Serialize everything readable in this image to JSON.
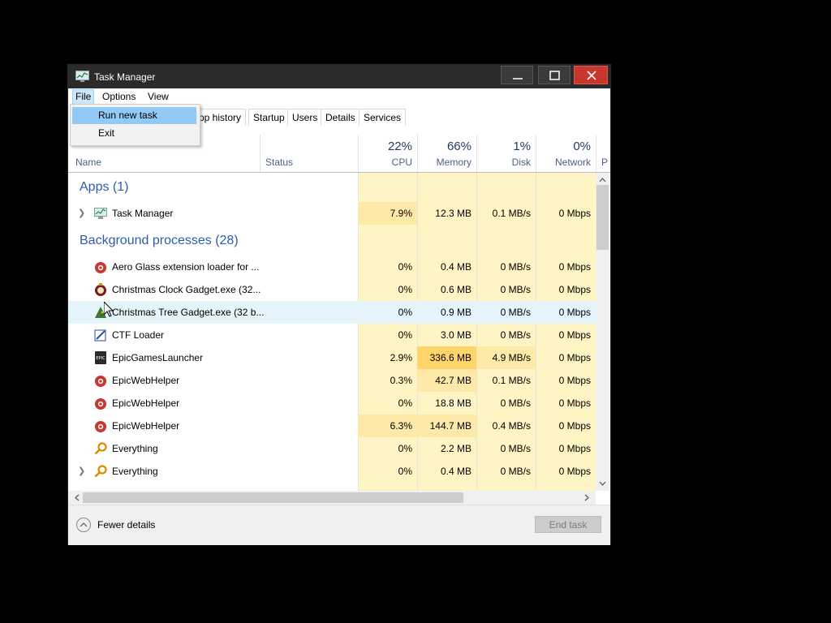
{
  "window": {
    "title": "Task Manager"
  },
  "menubar": {
    "file": "File",
    "options": "Options",
    "view": "View"
  },
  "file_menu": {
    "run_new_task": "Run new task",
    "exit": "Exit"
  },
  "tabs": [
    "pp history",
    "Startup",
    "Users",
    "Details",
    "Services"
  ],
  "columns": {
    "name": "Name",
    "status": "Status",
    "cpu": {
      "pct": "22%",
      "label": "CPU"
    },
    "memory": {
      "pct": "66%",
      "label": "Memory"
    },
    "disk": {
      "pct": "1%",
      "label": "Disk"
    },
    "network": {
      "pct": "0%",
      "label": "Network"
    },
    "power_partial": "P"
  },
  "groups": {
    "apps": "Apps (1)",
    "background": "Background processes (28)"
  },
  "apps": [
    {
      "name": "Task Manager",
      "cpu": "7.9%",
      "memory": "12.3 MB",
      "disk": "0.1 MB/s",
      "network": "0 Mbps",
      "icon": "taskmgr-icon",
      "expandable": true
    }
  ],
  "processes": [
    {
      "name": "Aero Glass extension loader for ...",
      "cpu": "0%",
      "memory": "0.4 MB",
      "disk": "0 MB/s",
      "network": "0 Mbps",
      "icon": "aeroglass-icon"
    },
    {
      "name": "Christmas Clock Gadget.exe (32...",
      "cpu": "0%",
      "memory": "0.6 MB",
      "disk": "0 MB/s",
      "network": "0 Mbps",
      "icon": "clock-gadget-icon"
    },
    {
      "name": "Christmas Tree Gadget.exe (32 b...",
      "cpu": "0%",
      "memory": "0.9 MB",
      "disk": "0 MB/s",
      "network": "0 Mbps",
      "icon": "tree-gadget-icon"
    },
    {
      "name": "CTF Loader",
      "cpu": "0%",
      "memory": "3.0 MB",
      "disk": "0 MB/s",
      "network": "0 Mbps",
      "icon": "ctf-icon"
    },
    {
      "name": "EpicGamesLauncher",
      "cpu": "2.9%",
      "memory": "336.6 MB",
      "disk": "4.9 MB/s",
      "network": "0 Mbps",
      "icon": "epic-icon"
    },
    {
      "name": "EpicWebHelper",
      "cpu": "0.3%",
      "memory": "42.7 MB",
      "disk": "0.1 MB/s",
      "network": "0 Mbps",
      "icon": "epicweb-icon"
    },
    {
      "name": "EpicWebHelper",
      "cpu": "0%",
      "memory": "18.8 MB",
      "disk": "0 MB/s",
      "network": "0 Mbps",
      "icon": "epicweb-icon"
    },
    {
      "name": "EpicWebHelper",
      "cpu": "6.3%",
      "memory": "144.7 MB",
      "disk": "0.4 MB/s",
      "network": "0 Mbps",
      "icon": "epicweb-icon"
    },
    {
      "name": "Everything",
      "cpu": "0%",
      "memory": "2.2 MB",
      "disk": "0 MB/s",
      "network": "0 Mbps",
      "icon": "everything-icon"
    },
    {
      "name": "Everything",
      "cpu": "0%",
      "memory": "0.4 MB",
      "disk": "0 MB/s",
      "network": "0 Mbps",
      "icon": "everything-icon",
      "expandable": true
    }
  ],
  "footer": {
    "fewer_details": "Fewer details",
    "end_task": "End task"
  },
  "colors": {
    "accent_blue": "#2b5fa8",
    "heat_low": "#fff4c4",
    "heat_mid": "#ffe9a8",
    "heat_high": "#ffd46a",
    "selected": "#91c9f7"
  }
}
